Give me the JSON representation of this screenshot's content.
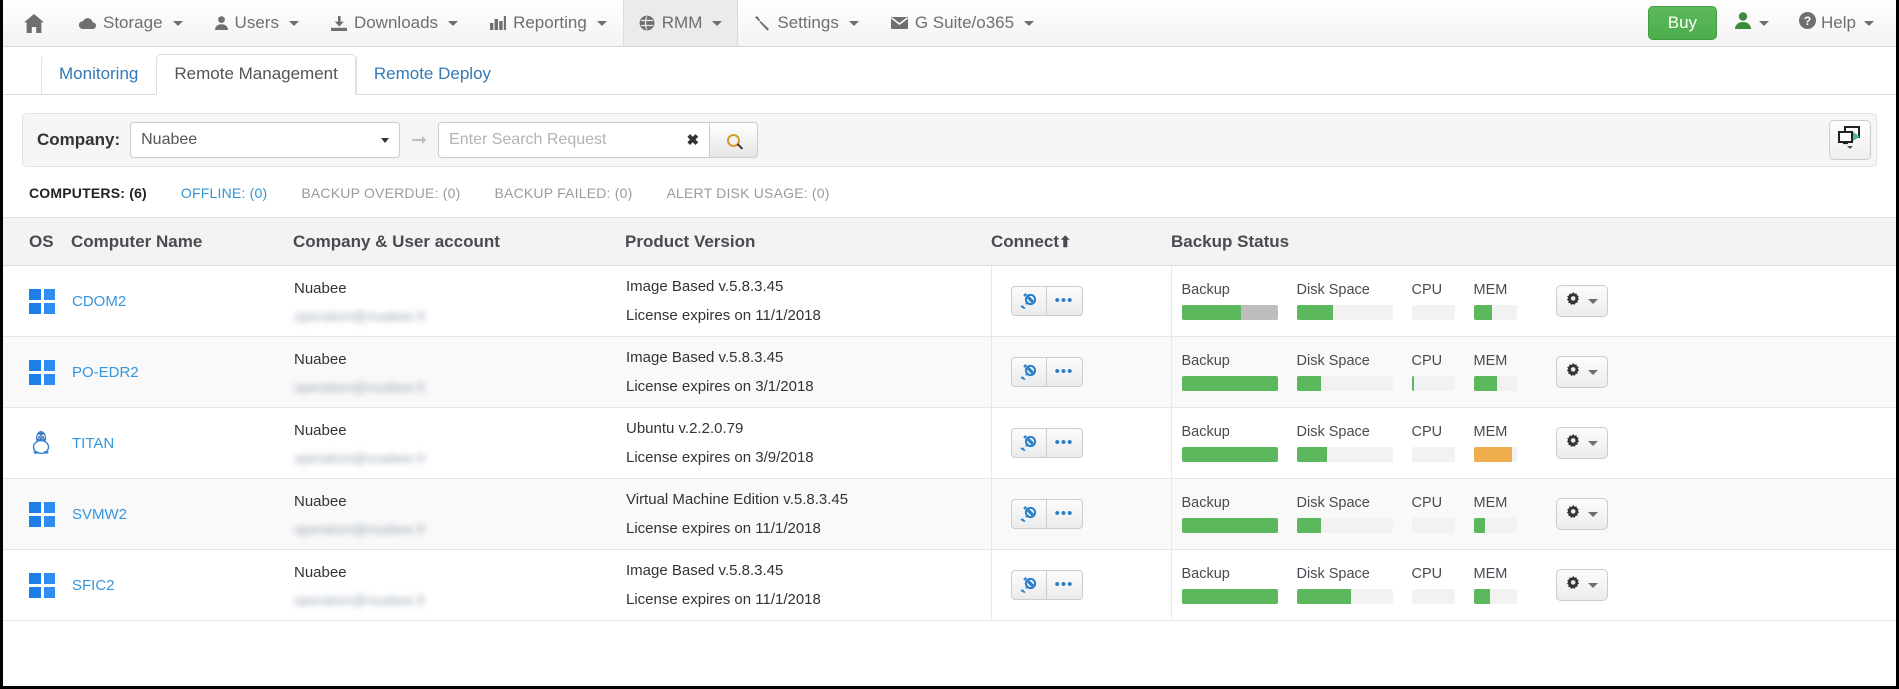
{
  "navbar": {
    "home_icon": "home-icon",
    "items": [
      {
        "label": "Storage",
        "icon": "cloud-icon",
        "caret": true,
        "active": false
      },
      {
        "label": "Users",
        "icon": "user-icon",
        "caret": true,
        "active": false
      },
      {
        "label": "Downloads",
        "icon": "download-icon",
        "caret": true,
        "active": false
      },
      {
        "label": "Reporting",
        "icon": "chart-icon",
        "caret": true,
        "active": false
      },
      {
        "label": "RMM",
        "icon": "globe-icon",
        "caret": true,
        "active": true
      },
      {
        "label": "Settings",
        "icon": "wrench-icon",
        "caret": true,
        "active": false
      },
      {
        "label": "G Suite/o365",
        "icon": "envelope-icon",
        "caret": true,
        "active": false
      }
    ],
    "buy_label": "Buy",
    "help_label": "Help",
    "account_icon": "user-icon",
    "help_icon": "question-circle-icon",
    "buy_color": "#5cb85c"
  },
  "tabs": [
    {
      "label": "Monitoring",
      "active": false
    },
    {
      "label": "Remote Management",
      "active": true
    },
    {
      "label": "Remote Deploy",
      "active": false
    }
  ],
  "filter": {
    "company_label": "Company:",
    "company_value": "Nuabee",
    "arrow_icon": "arrow-right-icon",
    "search_placeholder": "Enter Search Request",
    "search_value": "",
    "clear_icon": "clear-x-icon",
    "search_icon": "search-icon",
    "screen_share_icon": "screen-share-icon"
  },
  "counters": [
    {
      "label": "COMPUTERS:",
      "count": "(6)",
      "style": "dark"
    },
    {
      "label": "OFFLINE:",
      "count": "(0)",
      "style": "blue"
    },
    {
      "label": "BACKUP OVERDUE:",
      "count": "(0)",
      "style": "gray"
    },
    {
      "label": "BACKUP FAILED:",
      "count": "(0)",
      "style": "gray"
    },
    {
      "label": "ALERT DISK USAGE:",
      "count": "(0)",
      "style": "gray"
    }
  ],
  "table": {
    "headers": {
      "os": "OS",
      "computer_name": "Computer Name",
      "company_user": "Company & User account",
      "product_version": "Product Version",
      "connect": "Connect",
      "connect_sort_icon": "sort-asc-arrow-icon",
      "backup_status": "Backup Status"
    },
    "status_labels": {
      "backup": "Backup",
      "disk": "Disk Space",
      "cpu": "CPU",
      "mem": "MEM"
    },
    "colors": {
      "green": "#5cb85c",
      "orange": "#f0ad4e",
      "gray_fill": "#bdbdbd",
      "track": "#f2f2f2"
    },
    "rows": [
      {
        "os": "windows",
        "name": "CDOM2",
        "company": "Nuabee",
        "user_email": "operation@nuabee.fr",
        "product": "Image Based v.5.8.3.45",
        "license": "License expires on 11/1/2018",
        "connect_icon": "plug-icon",
        "more_icon": "ellipsis-icon",
        "gear_icon": "gear-icon",
        "backup_pct": 62,
        "backup_color": "#5cb85c",
        "backup_rest_color": "#bdbdbd",
        "disk_pct": 38,
        "disk_color": "#5cb85c",
        "cpu_pct": 0,
        "cpu_color": "#5cb85c",
        "mem_pct": 42,
        "mem_color": "#5cb85c"
      },
      {
        "os": "windows",
        "name": "PO-EDR2",
        "company": "Nuabee",
        "user_email": "operation@nuabee.fr",
        "product": "Image Based v.5.8.3.45",
        "license": "License expires on 3/1/2018",
        "connect_icon": "plug-icon",
        "more_icon": "ellipsis-icon",
        "gear_icon": "gear-icon",
        "backup_pct": 100,
        "backup_color": "#5cb85c",
        "backup_rest_color": "#f2f2f2",
        "disk_pct": 25,
        "disk_color": "#5cb85c",
        "cpu_pct": 6,
        "cpu_color": "#5cb85c",
        "mem_pct": 55,
        "mem_color": "#5cb85c"
      },
      {
        "os": "linux",
        "name": "TITAN",
        "company": "Nuabee",
        "user_email": "operation@nuabee.fr",
        "product": "Ubuntu v.2.2.0.79",
        "license": "License expires on 3/9/2018",
        "connect_icon": "plug-icon",
        "more_icon": "ellipsis-icon",
        "gear_icon": "gear-icon",
        "backup_pct": 100,
        "backup_color": "#5cb85c",
        "backup_rest_color": "#f2f2f2",
        "disk_pct": 32,
        "disk_color": "#5cb85c",
        "cpu_pct": 0,
        "cpu_color": "#5cb85c",
        "mem_pct": 90,
        "mem_color": "#f0ad4e"
      },
      {
        "os": "windows",
        "name": "SVMW2",
        "company": "Nuabee",
        "user_email": "operation@nuabee.fr",
        "product": "Virtual Machine Edition v.5.8.3.45",
        "license": "License expires on 11/1/2018",
        "connect_icon": "plug-icon",
        "more_icon": "ellipsis-icon",
        "gear_icon": "gear-icon",
        "backup_pct": 100,
        "backup_color": "#5cb85c",
        "backup_rest_color": "#f2f2f2",
        "disk_pct": 26,
        "disk_color": "#5cb85c",
        "cpu_pct": 0,
        "cpu_color": "#5cb85c",
        "mem_pct": 26,
        "mem_color": "#5cb85c"
      },
      {
        "os": "windows",
        "name": "SFIC2",
        "company": "Nuabee",
        "user_email": "operation@nuabee.fr",
        "product": "Image Based v.5.8.3.45",
        "license": "License expires on 11/1/2018",
        "connect_icon": "plug-icon",
        "more_icon": "ellipsis-icon",
        "gear_icon": "gear-icon",
        "backup_pct": 100,
        "backup_color": "#5cb85c",
        "backup_rest_color": "#f2f2f2",
        "disk_pct": 57,
        "disk_color": "#5cb85c",
        "cpu_pct": 0,
        "cpu_color": "#5cb85c",
        "mem_pct": 38,
        "mem_color": "#5cb85c"
      }
    ]
  }
}
